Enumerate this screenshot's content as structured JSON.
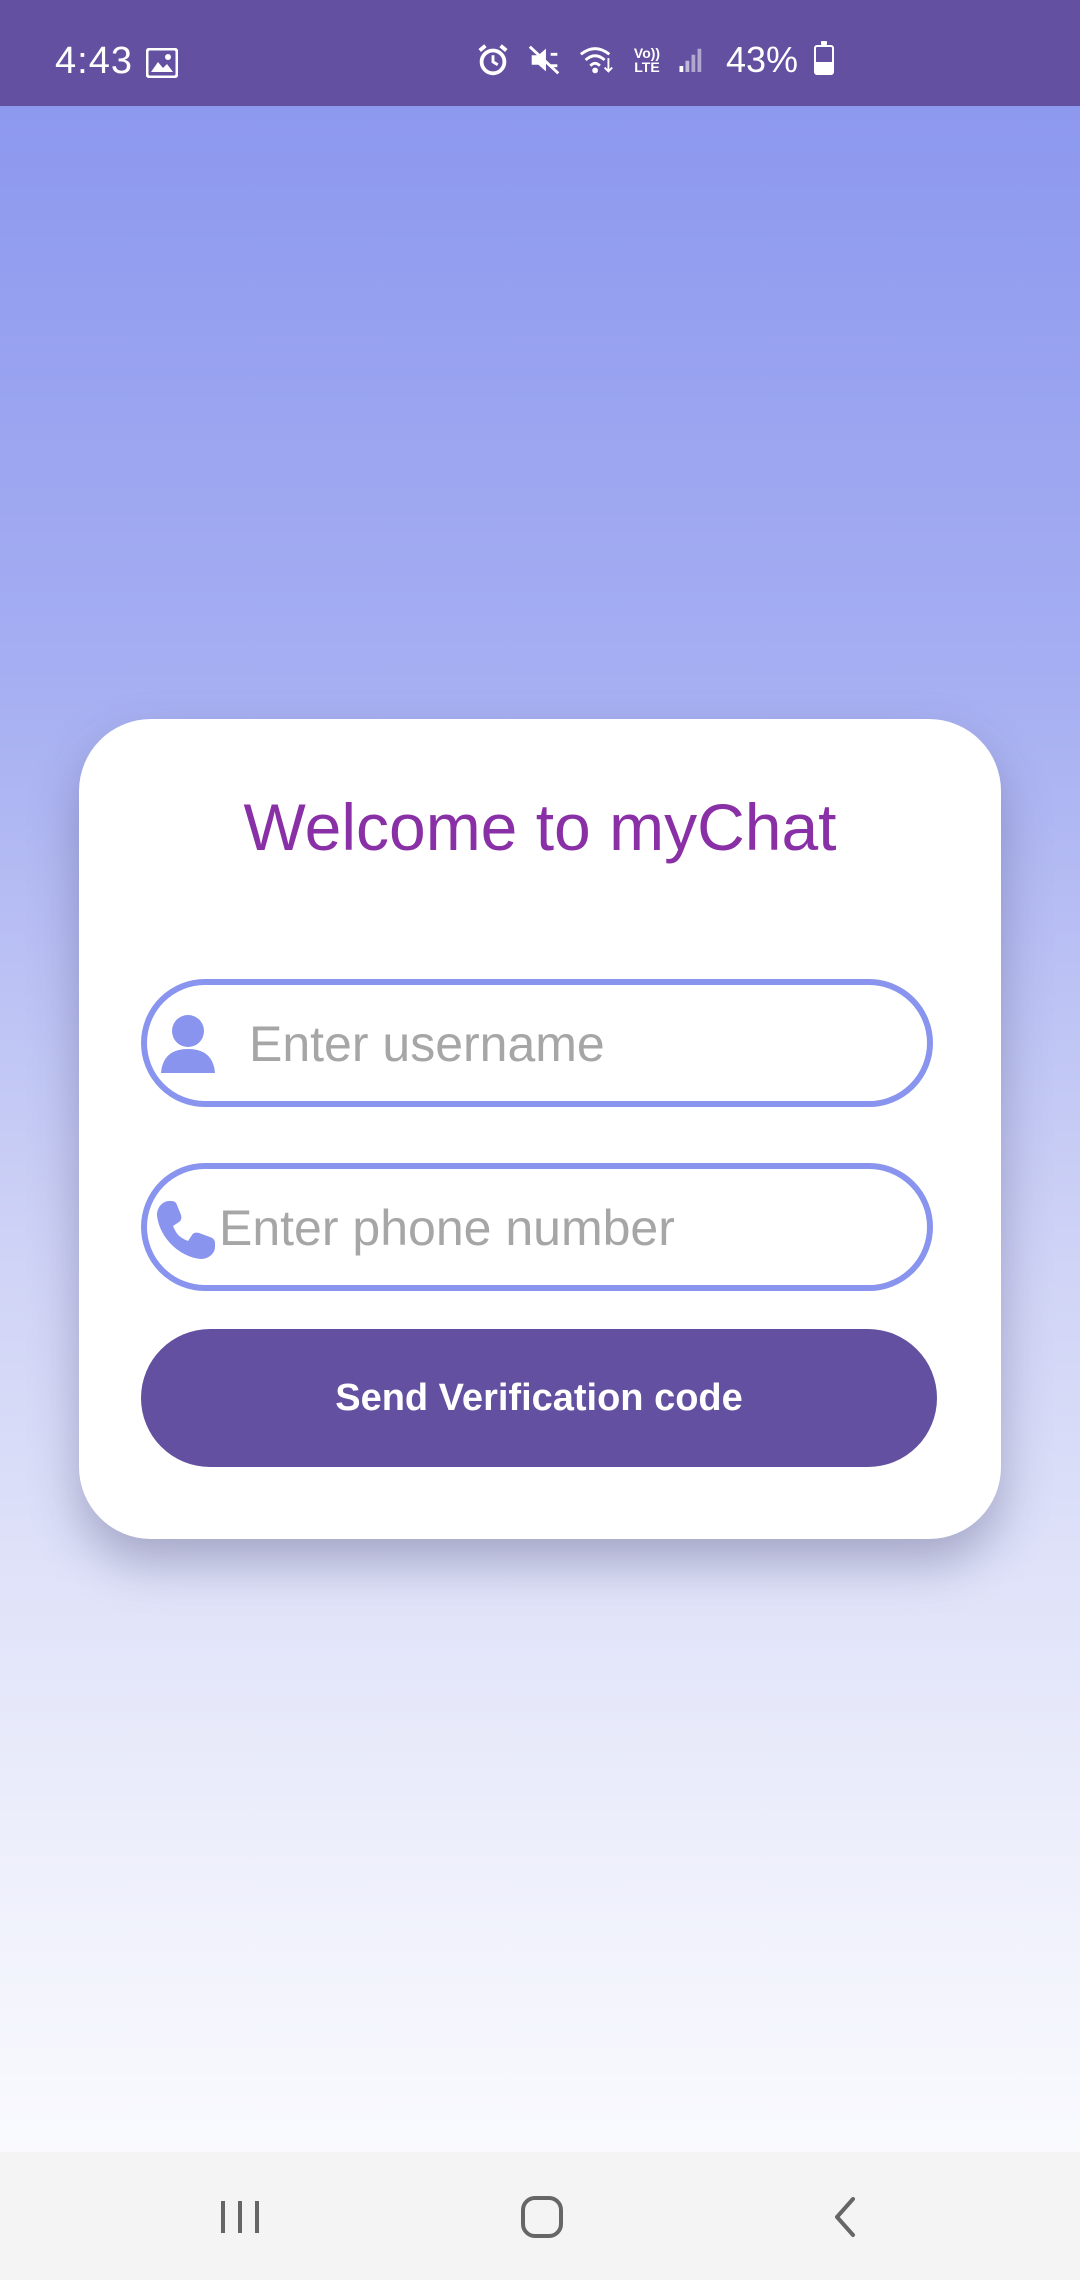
{
  "status_bar": {
    "time": "4:43",
    "volte_top": "Vo))",
    "volte_bottom": "LTE",
    "battery_percent": "43%",
    "battery_level": 0.43,
    "icons": [
      "gallery-icon",
      "alarm-icon",
      "mute-icon",
      "wifi-calling-icon",
      "volte-icon",
      "signal-icon",
      "battery-icon"
    ]
  },
  "login_card": {
    "title": "Welcome to myChat",
    "username_field": {
      "placeholder": "Enter username",
      "value": "",
      "icon": "user-icon"
    },
    "phone_field": {
      "placeholder": "Enter phone number",
      "value": "",
      "icon": "phone-icon"
    },
    "send_button_label": "Send Verification code"
  },
  "nav_bar": {
    "buttons": [
      "recent-apps-icon",
      "home-icon",
      "back-icon"
    ]
  },
  "colors": {
    "status_bar": "#6350a0",
    "accent": "#8894ee",
    "title": "#8a30a6",
    "button": "#6350a0",
    "placeholder": "#a6a6a6"
  }
}
